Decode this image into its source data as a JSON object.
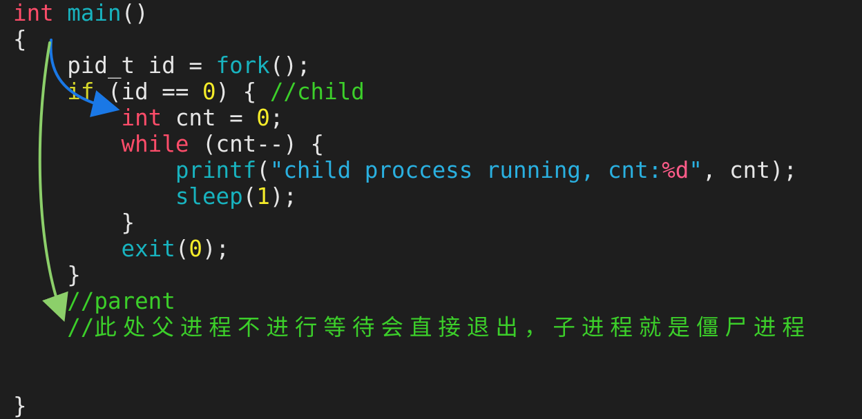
{
  "colors": {
    "background": "#1e1e1e",
    "keyword": "#ff4d6a",
    "function": "#18b3bf",
    "plain": "#e6e6e6",
    "number": "#f5ec2a",
    "if_keyword": "#d6d62a",
    "comment": "#3ccf2a",
    "string": "#2ab0e0",
    "format_spec": "#ff5c8a",
    "arrow_blue": "#1a78e6",
    "arrow_green": "#8ccf6a"
  },
  "code": {
    "lines": [
      {
        "tokens": [
          {
            "t": "int",
            "c": "keyword"
          },
          {
            "t": " ",
            "c": "plain"
          },
          {
            "t": "main",
            "c": "func"
          },
          {
            "t": "()",
            "c": "plain"
          }
        ]
      },
      {
        "tokens": [
          {
            "t": "{",
            "c": "plain"
          }
        ]
      },
      {
        "tokens": [
          {
            "t": "    pid_t id = ",
            "c": "plain"
          },
          {
            "t": "fork",
            "c": "func"
          },
          {
            "t": "();",
            "c": "plain"
          }
        ]
      },
      {
        "tokens": [
          {
            "t": "    ",
            "c": "plain"
          },
          {
            "t": "if",
            "c": "if"
          },
          {
            "t": " (id == ",
            "c": "plain"
          },
          {
            "t": "0",
            "c": "num"
          },
          {
            "t": ") { ",
            "c": "plain"
          },
          {
            "t": "//child",
            "c": "comment"
          }
        ]
      },
      {
        "tokens": [
          {
            "t": "        ",
            "c": "plain"
          },
          {
            "t": "int",
            "c": "keyword"
          },
          {
            "t": " cnt = ",
            "c": "plain"
          },
          {
            "t": "0",
            "c": "num"
          },
          {
            "t": ";",
            "c": "plain"
          }
        ]
      },
      {
        "tokens": [
          {
            "t": "        ",
            "c": "plain"
          },
          {
            "t": "while",
            "c": "keyword"
          },
          {
            "t": " (cnt--) {",
            "c": "plain"
          }
        ]
      },
      {
        "tokens": [
          {
            "t": "            ",
            "c": "plain"
          },
          {
            "t": "printf",
            "c": "func"
          },
          {
            "t": "(",
            "c": "plain"
          },
          {
            "t": "\"child proccess running, cnt:",
            "c": "string"
          },
          {
            "t": "%d",
            "c": "fmt"
          },
          {
            "t": "\"",
            "c": "string"
          },
          {
            "t": ", cnt);",
            "c": "plain"
          }
        ]
      },
      {
        "tokens": [
          {
            "t": "            ",
            "c": "plain"
          },
          {
            "t": "sleep",
            "c": "func"
          },
          {
            "t": "(",
            "c": "plain"
          },
          {
            "t": "1",
            "c": "num"
          },
          {
            "t": ");",
            "c": "plain"
          }
        ]
      },
      {
        "tokens": [
          {
            "t": "        }",
            "c": "plain"
          }
        ]
      },
      {
        "tokens": [
          {
            "t": "        ",
            "c": "plain"
          },
          {
            "t": "exit",
            "c": "func"
          },
          {
            "t": "(",
            "c": "plain"
          },
          {
            "t": "0",
            "c": "num"
          },
          {
            "t": ");",
            "c": "plain"
          }
        ]
      },
      {
        "tokens": [
          {
            "t": "    }",
            "c": "plain"
          }
        ]
      },
      {
        "tokens": [
          {
            "t": "    ",
            "c": "plain"
          },
          {
            "t": "//parent",
            "c": "comment"
          }
        ]
      },
      {
        "tokens": [
          {
            "t": "    ",
            "c": "plain"
          },
          {
            "t": "//",
            "c": "comment"
          },
          {
            "t": "此处父进程不进行等待会直接退出，子进程就是僵尸进程",
            "c": "comment",
            "cjk": true
          }
        ]
      },
      {
        "tokens": []
      },
      {
        "tokens": []
      },
      {
        "tokens": [
          {
            "t": "}",
            "c": "plain"
          }
        ]
      }
    ]
  },
  "annotations": {
    "blue_arrow": {
      "name": "fork-to-child-arrow",
      "color": "#1a78e6"
    },
    "green_arrow": {
      "name": "fork-to-parent-arrow",
      "color": "#8ccf6a"
    }
  }
}
